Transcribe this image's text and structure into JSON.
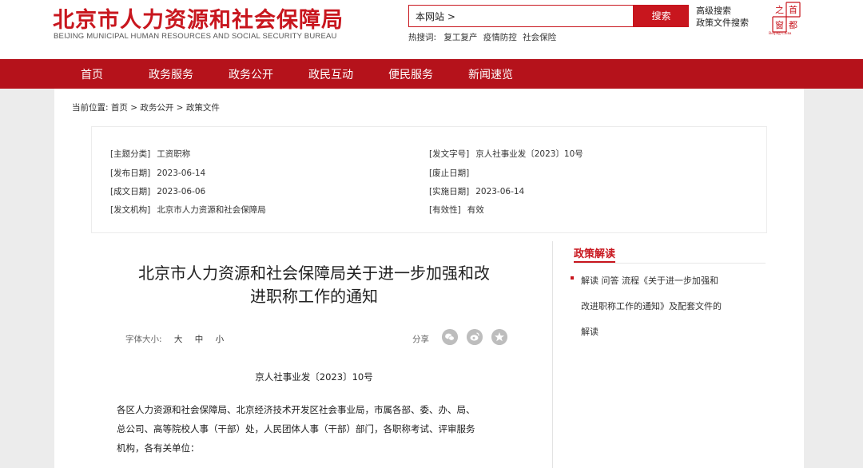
{
  "header": {
    "logo_cn": "北京市人力资源和社会保障局",
    "logo_en": "BEIJING MUNICIPAL HUMAN RESOURCES AND SOCIAL SECURITY BUREAU",
    "search_scope": "本网站 >",
    "search_button": "搜索",
    "hot_label": "热搜词:",
    "hot_words": [
      "复工复产",
      "疫情防控",
      "社会保险"
    ],
    "advanced_search": "高级搜索",
    "policy_search": "政策文件搜索",
    "seal_chars": [
      "首",
      "都",
      "之",
      "窗"
    ],
    "seal_en": "Beijing·China"
  },
  "nav": {
    "items": [
      "首页",
      "政务服务",
      "政务公开",
      "政民互动",
      "便民服务",
      "新闻速览"
    ]
  },
  "breadcrumb": "当前位置: 首页 > 政务公开 > 政策文件",
  "meta": {
    "left": [
      {
        "label": "[主题分类]",
        "value": "工资职称"
      },
      {
        "label": "[发布日期]",
        "value": "2023-06-14"
      },
      {
        "label": "[成文日期]",
        "value": "2023-06-06"
      },
      {
        "label": "[发文机构]",
        "value": "北京市人力资源和社会保障局"
      }
    ],
    "right": [
      {
        "label": "[发文字号]",
        "value": "京人社事业发〔2023〕10号"
      },
      {
        "label": "[废止日期]",
        "value": ""
      },
      {
        "label": "[实施日期]",
        "value": "2023-06-14"
      },
      {
        "label": "[有效性]",
        "value": "有效"
      }
    ]
  },
  "article": {
    "title_line1": "北京市人力资源和社会保障局关于进一步加强和改",
    "title_line2": "进职称工作的通知",
    "font_size_label": "字体大小:",
    "font_sizes": [
      "大",
      "中",
      "小"
    ],
    "share_label": "分享",
    "share_icons": [
      "wechat-icon",
      "weibo-icon",
      "star-icon"
    ],
    "doc_number": "京人社事业发〔2023〕10号",
    "body_lines": [
      "各区人力资源和社会保障局、北京经济技术开发区社会事业局，市属各部、委、办、局、",
      "总公司、高等院校人事（干部）处，人民团体人事（干部）部门，各职称考试、评审服务",
      "机构，各有关单位："
    ]
  },
  "sidebar": {
    "title": "政策解读",
    "link_lines": [
      "解读 问答 流程《关于进一步加强和",
      "改进职称工作的通知》及配套文件的",
      "解读"
    ]
  },
  "colors": {
    "brand_red": "#c8161e",
    "nav_red": "#b5121b"
  }
}
